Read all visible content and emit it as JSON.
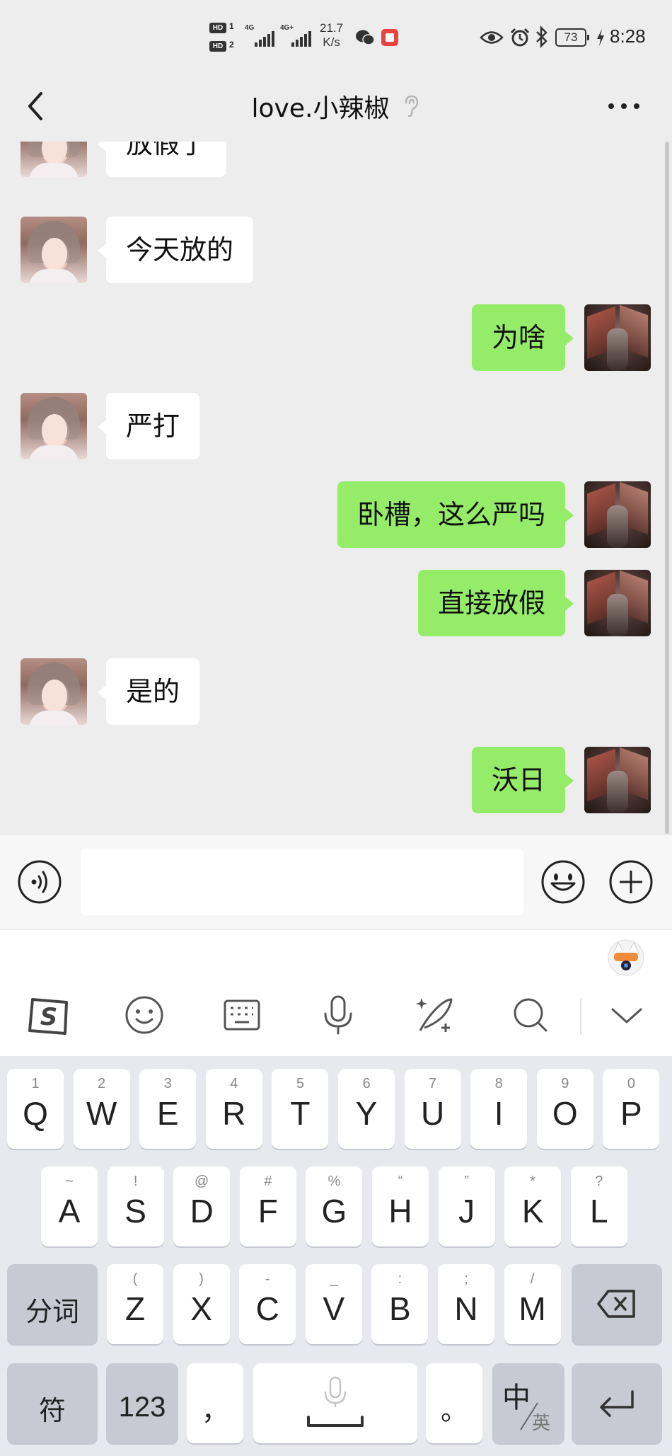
{
  "status_bar": {
    "hd1": "HD",
    "hd1_num": "1",
    "hd2": "HD",
    "hd2_num": "2",
    "net1": "4G",
    "net2": "4G+",
    "speed_value": "21.7",
    "speed_unit": "K/s",
    "battery": "73",
    "time": "8:28",
    "icons": [
      "wechat-icon",
      "app-notification-icon",
      "eye-icon",
      "alarm-icon",
      "bluetooth-icon",
      "charging-icon"
    ]
  },
  "nav": {
    "title": "love.小辣椒",
    "back_icon": "back-arrow-icon",
    "earpiece_icon": "ear-icon",
    "more_icon": "more-dots-icon"
  },
  "messages": [
    {
      "side": "left",
      "text": "放假了"
    },
    {
      "side": "left",
      "text": "今天放的"
    },
    {
      "side": "right",
      "text": "为啥"
    },
    {
      "side": "left",
      "text": "严打"
    },
    {
      "side": "right",
      "text": "卧槽，这么严吗"
    },
    {
      "side": "right",
      "text": "直接放假"
    },
    {
      "side": "left",
      "text": "是的"
    },
    {
      "side": "right",
      "text": "沃日"
    }
  ],
  "input": {
    "value": "",
    "voice_icon": "voice-input-icon",
    "emoji_icon": "emoji-icon",
    "plus_icon": "plus-icon"
  },
  "ime_toolbar": {
    "items": [
      "sogou-logo-icon",
      "emoji-face-icon",
      "keyboard-icon",
      "microphone-icon",
      "handwriting-icon",
      "search-icon",
      "collapse-chevron-icon"
    ],
    "mascot": "ime-mascot-icon"
  },
  "keyboard": {
    "row1": [
      {
        "hint": "1",
        "key": "Q"
      },
      {
        "hint": "2",
        "key": "W"
      },
      {
        "hint": "3",
        "key": "E"
      },
      {
        "hint": "4",
        "key": "R"
      },
      {
        "hint": "5",
        "key": "T"
      },
      {
        "hint": "6",
        "key": "Y"
      },
      {
        "hint": "7",
        "key": "U"
      },
      {
        "hint": "8",
        "key": "I"
      },
      {
        "hint": "9",
        "key": "O"
      },
      {
        "hint": "0",
        "key": "P"
      }
    ],
    "row2": [
      {
        "hint": "~",
        "key": "A"
      },
      {
        "hint": "!",
        "key": "S"
      },
      {
        "hint": "@",
        "key": "D"
      },
      {
        "hint": "#",
        "key": "F"
      },
      {
        "hint": "%",
        "key": "G"
      },
      {
        "hint": "“",
        "key": "H"
      },
      {
        "hint": "”",
        "key": "J"
      },
      {
        "hint": "*",
        "key": "K"
      },
      {
        "hint": "?",
        "key": "L"
      }
    ],
    "row3": [
      {
        "hint": "(",
        "key": "Z"
      },
      {
        "hint": ")",
        "key": "X"
      },
      {
        "hint": "-",
        "key": "C"
      },
      {
        "hint": "_",
        "key": "V"
      },
      {
        "hint": ":",
        "key": "B"
      },
      {
        "hint": ";",
        "key": "N"
      },
      {
        "hint": "/",
        "key": "M"
      }
    ],
    "fenci": "分词",
    "fu": "符",
    "num": "123",
    "comma": "，",
    "period": "。",
    "lang_main": "中",
    "lang_sub": "英",
    "backspace_icon": "backspace-icon",
    "enter_icon": "enter-icon",
    "space_icon": "space-mic-icon"
  }
}
